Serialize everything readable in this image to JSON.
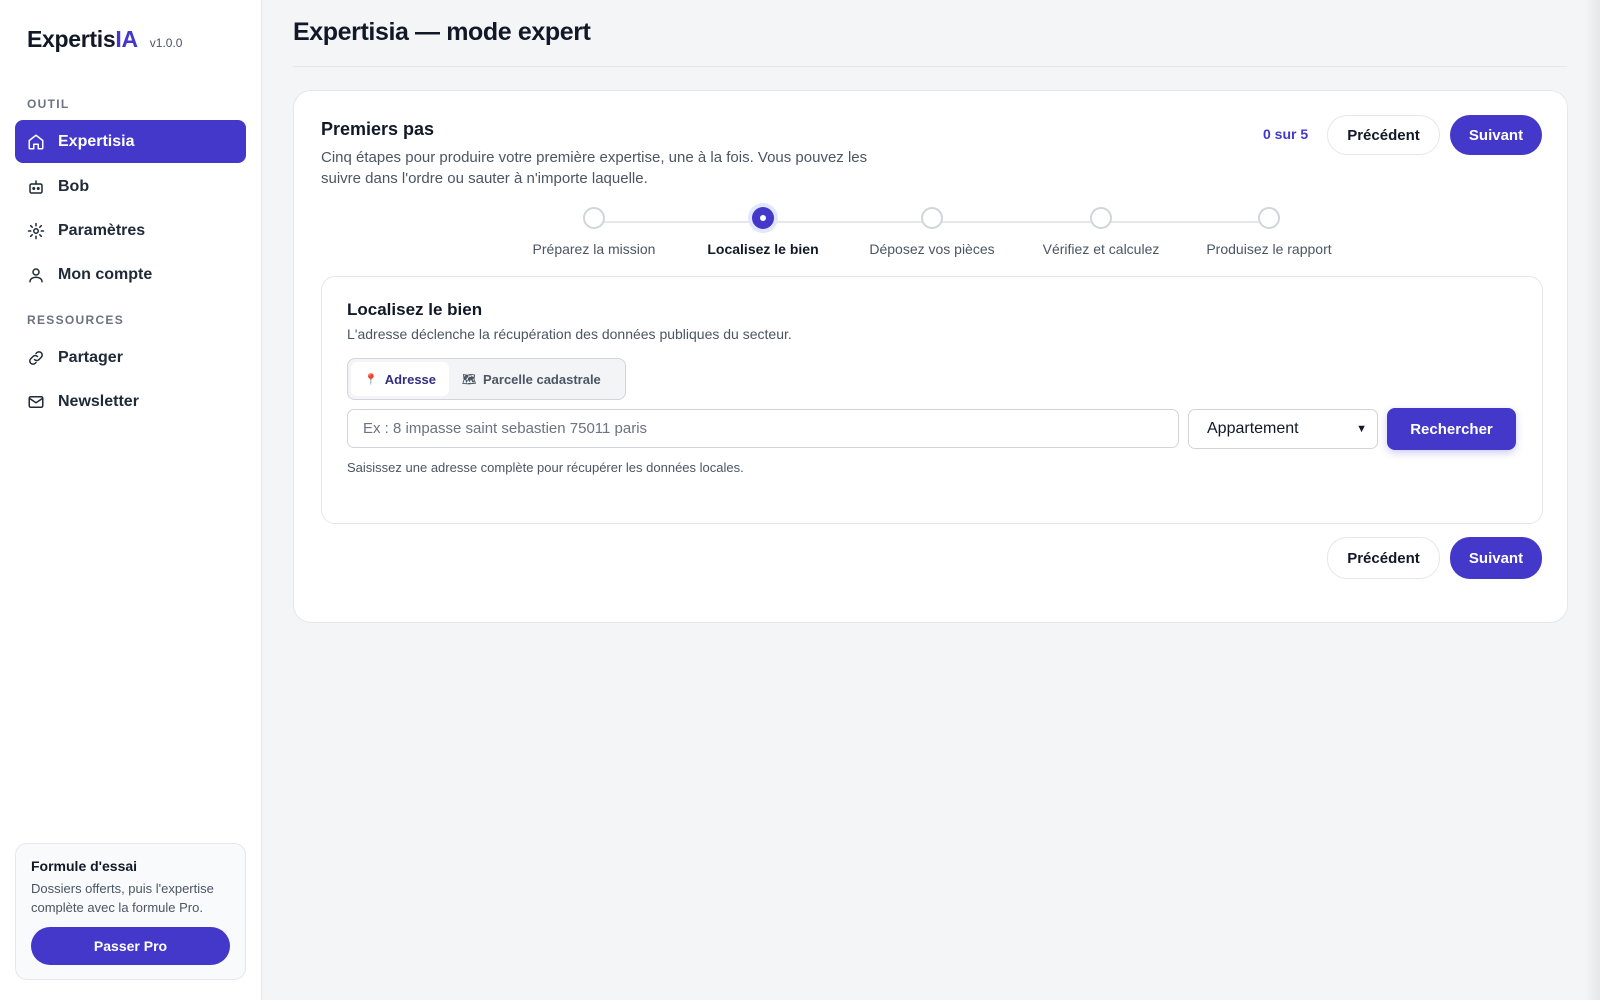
{
  "brand": {
    "name": "Expertis",
    "accent": "IA",
    "version": "v1.0.0"
  },
  "sidebar": {
    "sections": [
      {
        "label": "OUTIL"
      },
      {
        "label": "RESSOURCES"
      }
    ],
    "items": [
      {
        "label": "Expertisia",
        "icon": "home-icon",
        "active": true
      },
      {
        "label": "Bob",
        "icon": "robot-icon"
      },
      {
        "label": "Paramètres",
        "icon": "gear-icon"
      },
      {
        "label": "Mon compte",
        "icon": "user-icon"
      },
      {
        "label": "Partager",
        "icon": "link-icon"
      },
      {
        "label": "Newsletter",
        "icon": "mail-icon"
      }
    ],
    "trial": {
      "title": "Formule d'essai",
      "text": "Dossiers offerts, puis l'expertise complète avec la formule Pro.",
      "button": "Passer Pro"
    }
  },
  "page": {
    "title": "Expertisia — mode expert"
  },
  "wizard": {
    "title": "Premiers pas",
    "description": "Cinq étapes pour produire votre première expertise, une à la fois. Vous pouvez les suivre dans l'ordre ou sauter à n'importe laquelle.",
    "progress": "0 sur 5",
    "prev_label": "Précédent",
    "next_label": "Suivant",
    "current_step": 2,
    "steps": [
      {
        "label": "Préparez la mission"
      },
      {
        "label": "Localisez le bien"
      },
      {
        "label": "Déposez vos pièces"
      },
      {
        "label": "Vérifiez et calculez"
      },
      {
        "label": "Produisez le rapport"
      }
    ]
  },
  "locate": {
    "title": "Localisez le bien",
    "description": "L'adresse déclenche la récupération des données publiques du secteur.",
    "tabs": [
      {
        "label": "Adresse",
        "icon": "pin-icon",
        "active": true
      },
      {
        "label": "Parcelle cadastrale",
        "icon": "map-icon"
      }
    ],
    "address_placeholder": "Ex : 8 impasse saint sebastien 75011 paris",
    "address_value": "",
    "property_type": "Appartement",
    "search_label": "Rechercher",
    "help": "Saisissez une adresse complète pour récupérer les données locales."
  },
  "colors": {
    "accent": "#4338ca",
    "accent_dark": "#312e81",
    "border": "#e5e7eb"
  }
}
